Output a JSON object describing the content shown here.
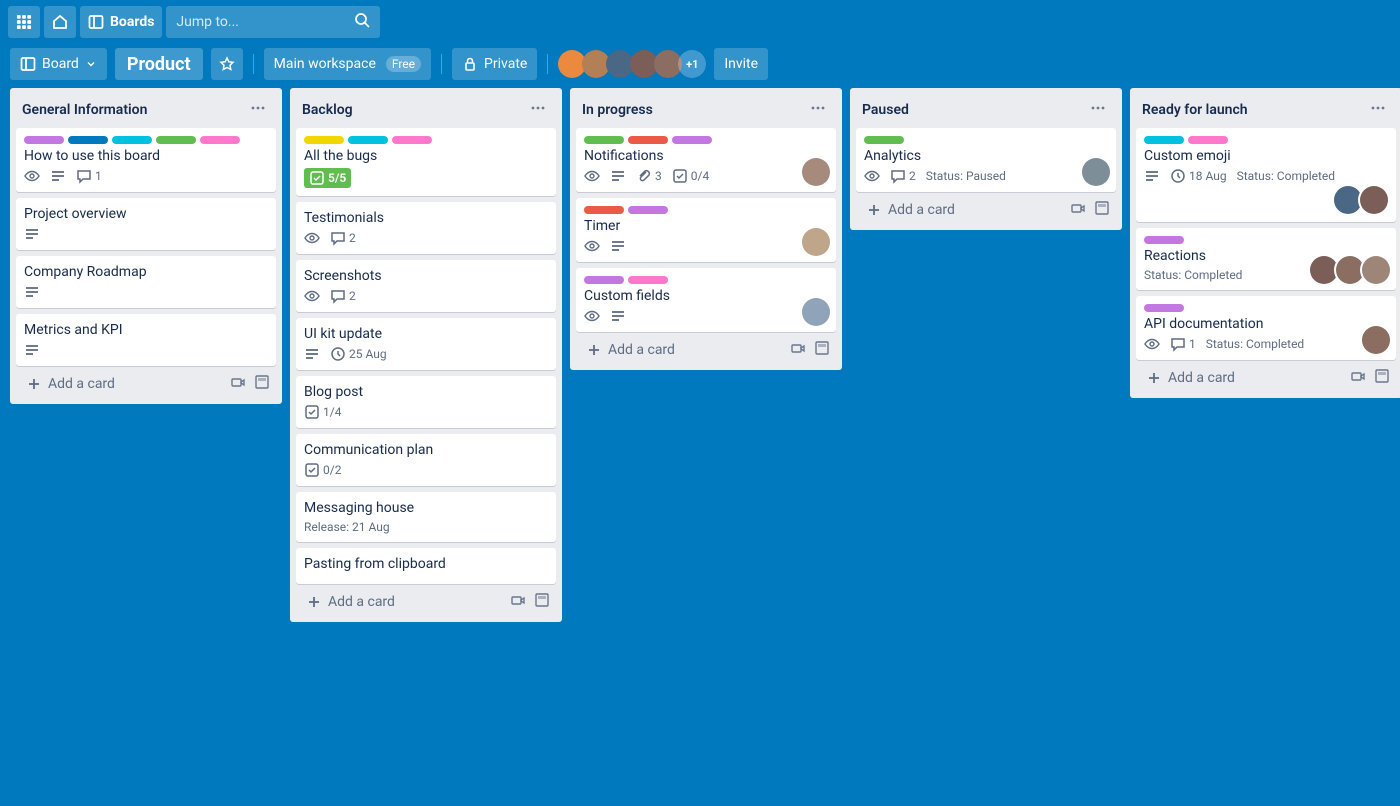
{
  "topnav": {
    "boards_label": "Boards",
    "jump_placeholder": "Jump to..."
  },
  "boardbar": {
    "board_view_label": "Board",
    "board_name": "Product",
    "workspace_label": "Main workspace",
    "workspace_pill": "Free",
    "visibility_label": "Private",
    "member_overflow": "+1",
    "invite_label": "Invite"
  },
  "add_card_label": "Add a card",
  "lists": [
    {
      "title": "General Information",
      "cards": [
        {
          "title": "How to use this board",
          "labels": [
            "purple",
            "blue",
            "cyan",
            "green",
            "pink"
          ],
          "badges": {
            "watch": true,
            "desc": true,
            "comments": "1"
          }
        },
        {
          "title": "Project overview",
          "badges": {
            "desc": true
          }
        },
        {
          "title": "Company Roadmap",
          "badges": {
            "desc": true
          }
        },
        {
          "title": "Metrics and KPI",
          "badges": {
            "desc": true
          }
        }
      ]
    },
    {
      "title": "Backlog",
      "cards": [
        {
          "title": "All the bugs",
          "labels": [
            "yellow",
            "cyan",
            "pink"
          ],
          "badges": {
            "check_fill": "5/5"
          }
        },
        {
          "title": "Testimonials",
          "badges": {
            "watch": true,
            "comments": "2"
          }
        },
        {
          "title": "Screenshots",
          "badges": {
            "watch": true,
            "comments": "2"
          }
        },
        {
          "title": "UI kit update",
          "badges": {
            "due": "25 Aug",
            "desc": true
          }
        },
        {
          "title": "Blog post",
          "badges": {
            "check": "1/4"
          }
        },
        {
          "title": "Communication plan",
          "badges": {
            "check": "0/2"
          }
        },
        {
          "title": "Messaging house",
          "status": "Release: 21 Aug"
        },
        {
          "title": "Pasting from clipboard"
        }
      ]
    },
    {
      "title": "In progress",
      "cards": [
        {
          "title": "Notifications",
          "labels": [
            "green",
            "red",
            "purple"
          ],
          "badges": {
            "watch": true,
            "desc": true,
            "attach": "3",
            "check": "0/4"
          },
          "avatars": 1,
          "abs_av": true
        },
        {
          "title": "Timer",
          "labels": [
            "red",
            "purple"
          ],
          "badges": {
            "watch": true,
            "desc": true
          },
          "avatars": 1,
          "abs_av": true
        },
        {
          "title": "Custom fields",
          "labels": [
            "purple",
            "pink"
          ],
          "badges": {
            "watch": true,
            "desc": true
          },
          "avatars": 1,
          "abs_av": true
        }
      ]
    },
    {
      "title": "Paused",
      "cards": [
        {
          "title": "Analytics",
          "labels": [
            "green"
          ],
          "badges": {
            "watch": true,
            "comments": "2"
          },
          "status": "Status: Paused",
          "avatars": 1,
          "abs_av": true
        }
      ]
    },
    {
      "title": "Ready for launch",
      "cards": [
        {
          "title": "Custom emoji",
          "labels": [
            "cyan",
            "pink"
          ],
          "badges": {
            "due": "18 Aug",
            "desc": true
          },
          "status": "Status: Completed",
          "avatars": 2
        },
        {
          "title": "Reactions",
          "labels": [
            "purple"
          ],
          "status": "Status: Completed",
          "avatars": 3,
          "abs_av": true
        },
        {
          "title": "API documentation",
          "labels": [
            "purple"
          ],
          "badges": {
            "watch": true,
            "comments": "1"
          },
          "status": "Status: Completed",
          "avatars": 1,
          "abs_av": true
        }
      ]
    }
  ]
}
